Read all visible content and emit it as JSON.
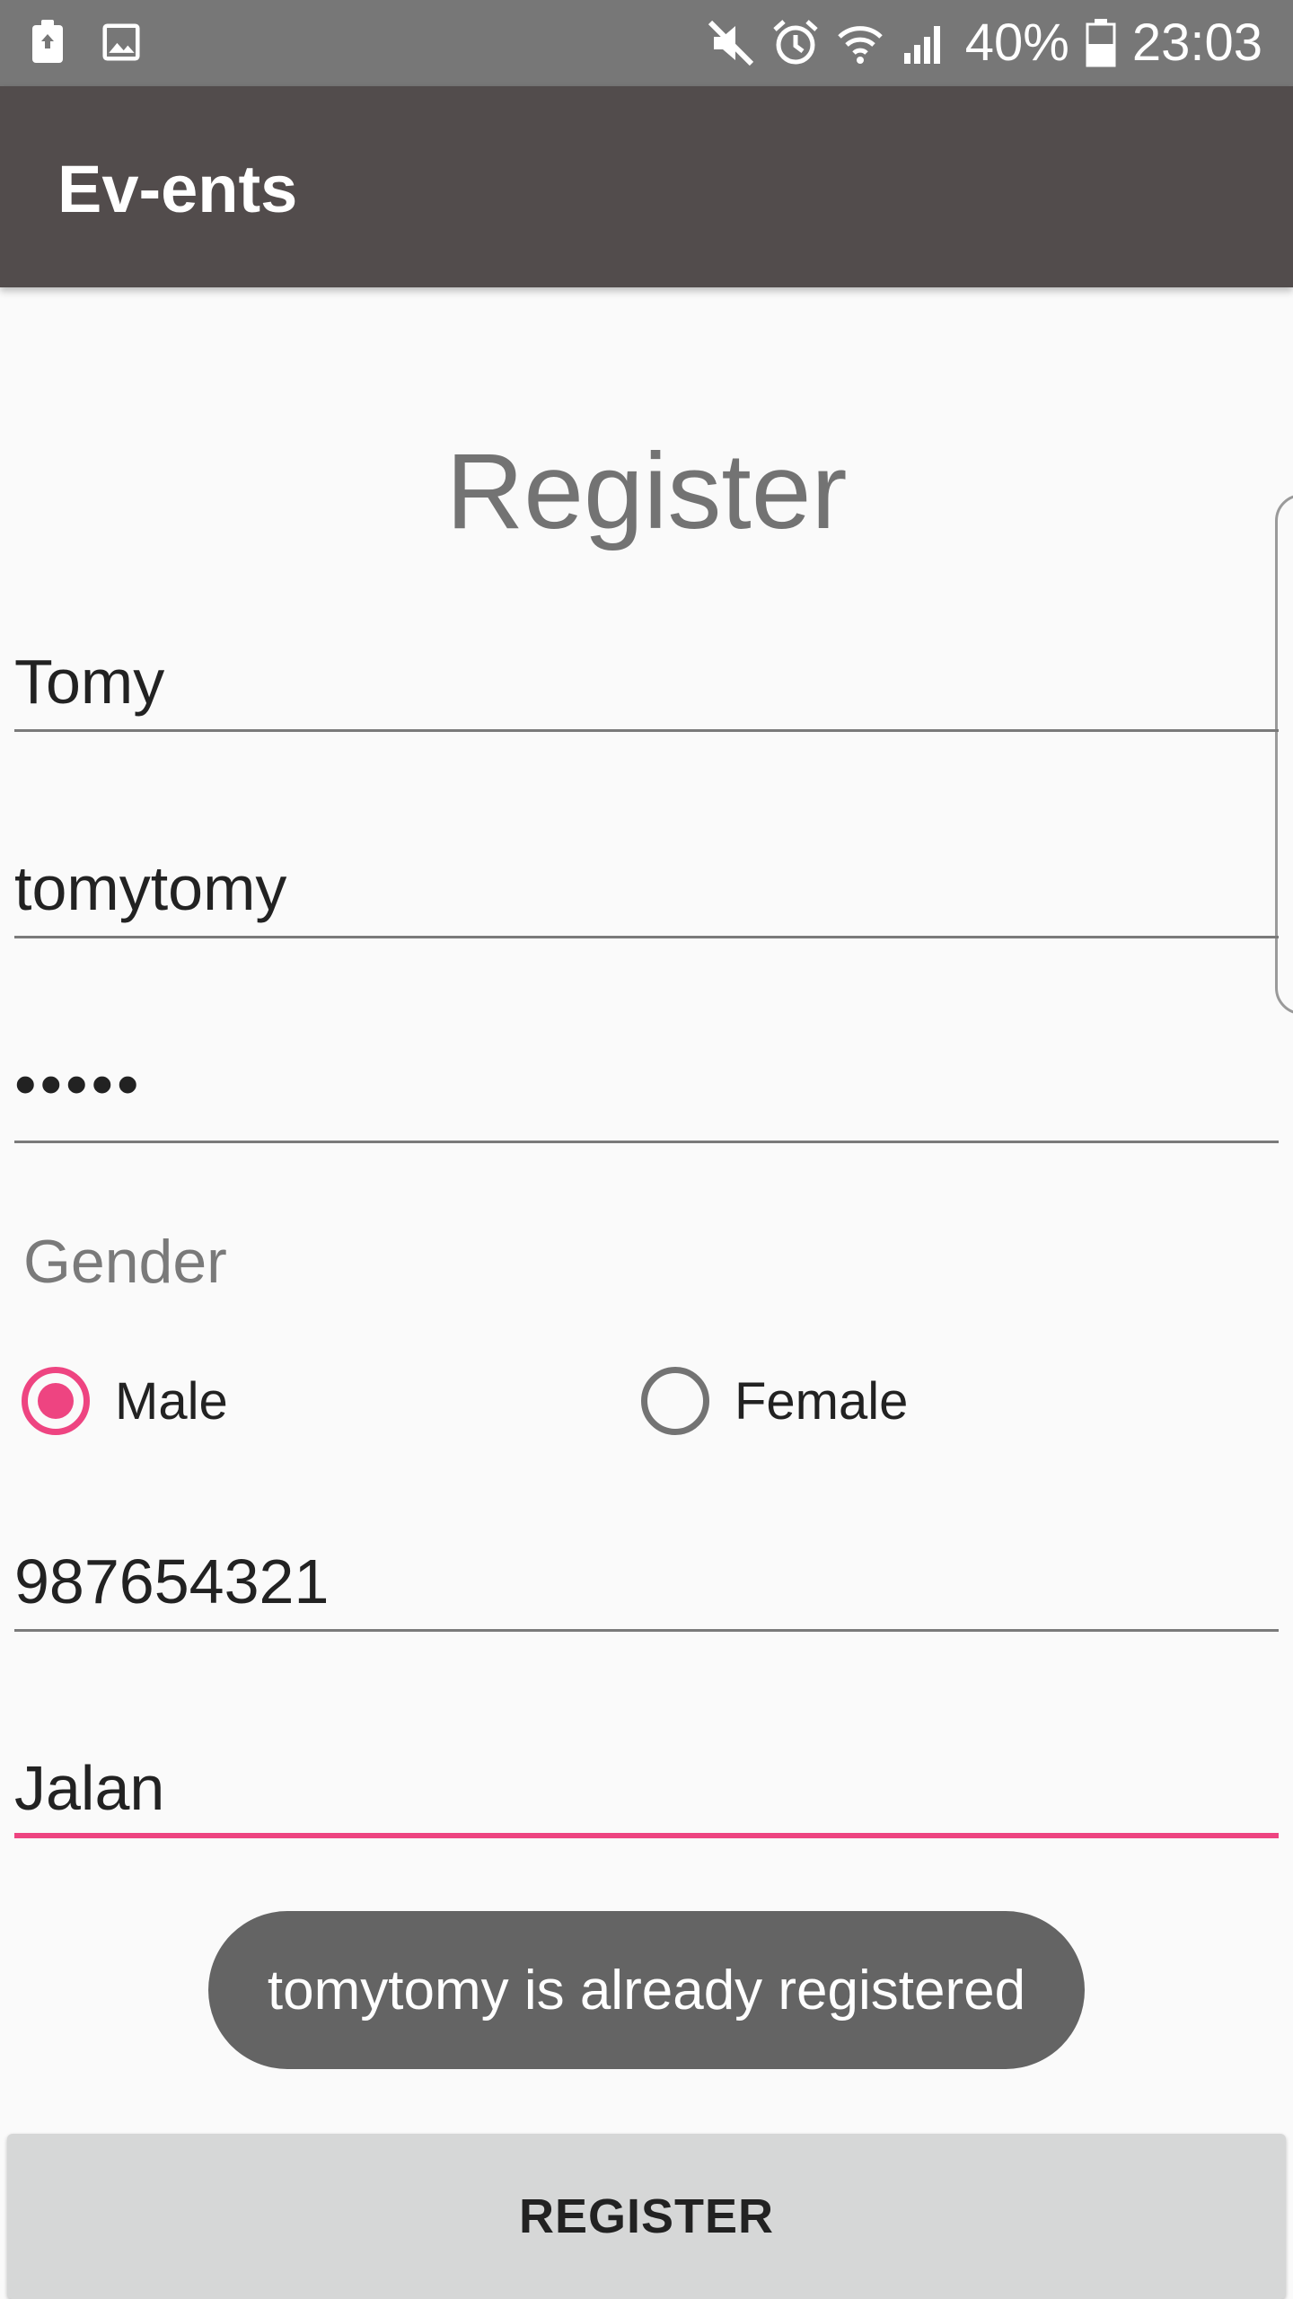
{
  "status_bar": {
    "battery_percent": "40%",
    "time": "23:03",
    "icons": [
      "battery-saver-icon",
      "image-icon",
      "mute-icon",
      "alarm-icon",
      "wifi-icon",
      "signal-icon",
      "battery-icon"
    ]
  },
  "app_bar": {
    "title": "Ev-ents"
  },
  "form": {
    "heading": "Register",
    "name_value": "Tomy",
    "username_value": "tomytomy",
    "password_mask": "•••••",
    "gender_label": "Gender",
    "gender_options": [
      {
        "label": "Male",
        "selected": true
      },
      {
        "label": "Female",
        "selected": false
      }
    ],
    "phone_value": "987654321",
    "address_value": "Jalan"
  },
  "toast": {
    "message": "tomytomy is already registered"
  },
  "register_button": {
    "label": "REGISTER"
  },
  "colors": {
    "status_bar": "#777777",
    "app_bar": "#524c4c",
    "accent": "#ee4481",
    "toast": "#646464",
    "button": "#d6d7d7"
  }
}
